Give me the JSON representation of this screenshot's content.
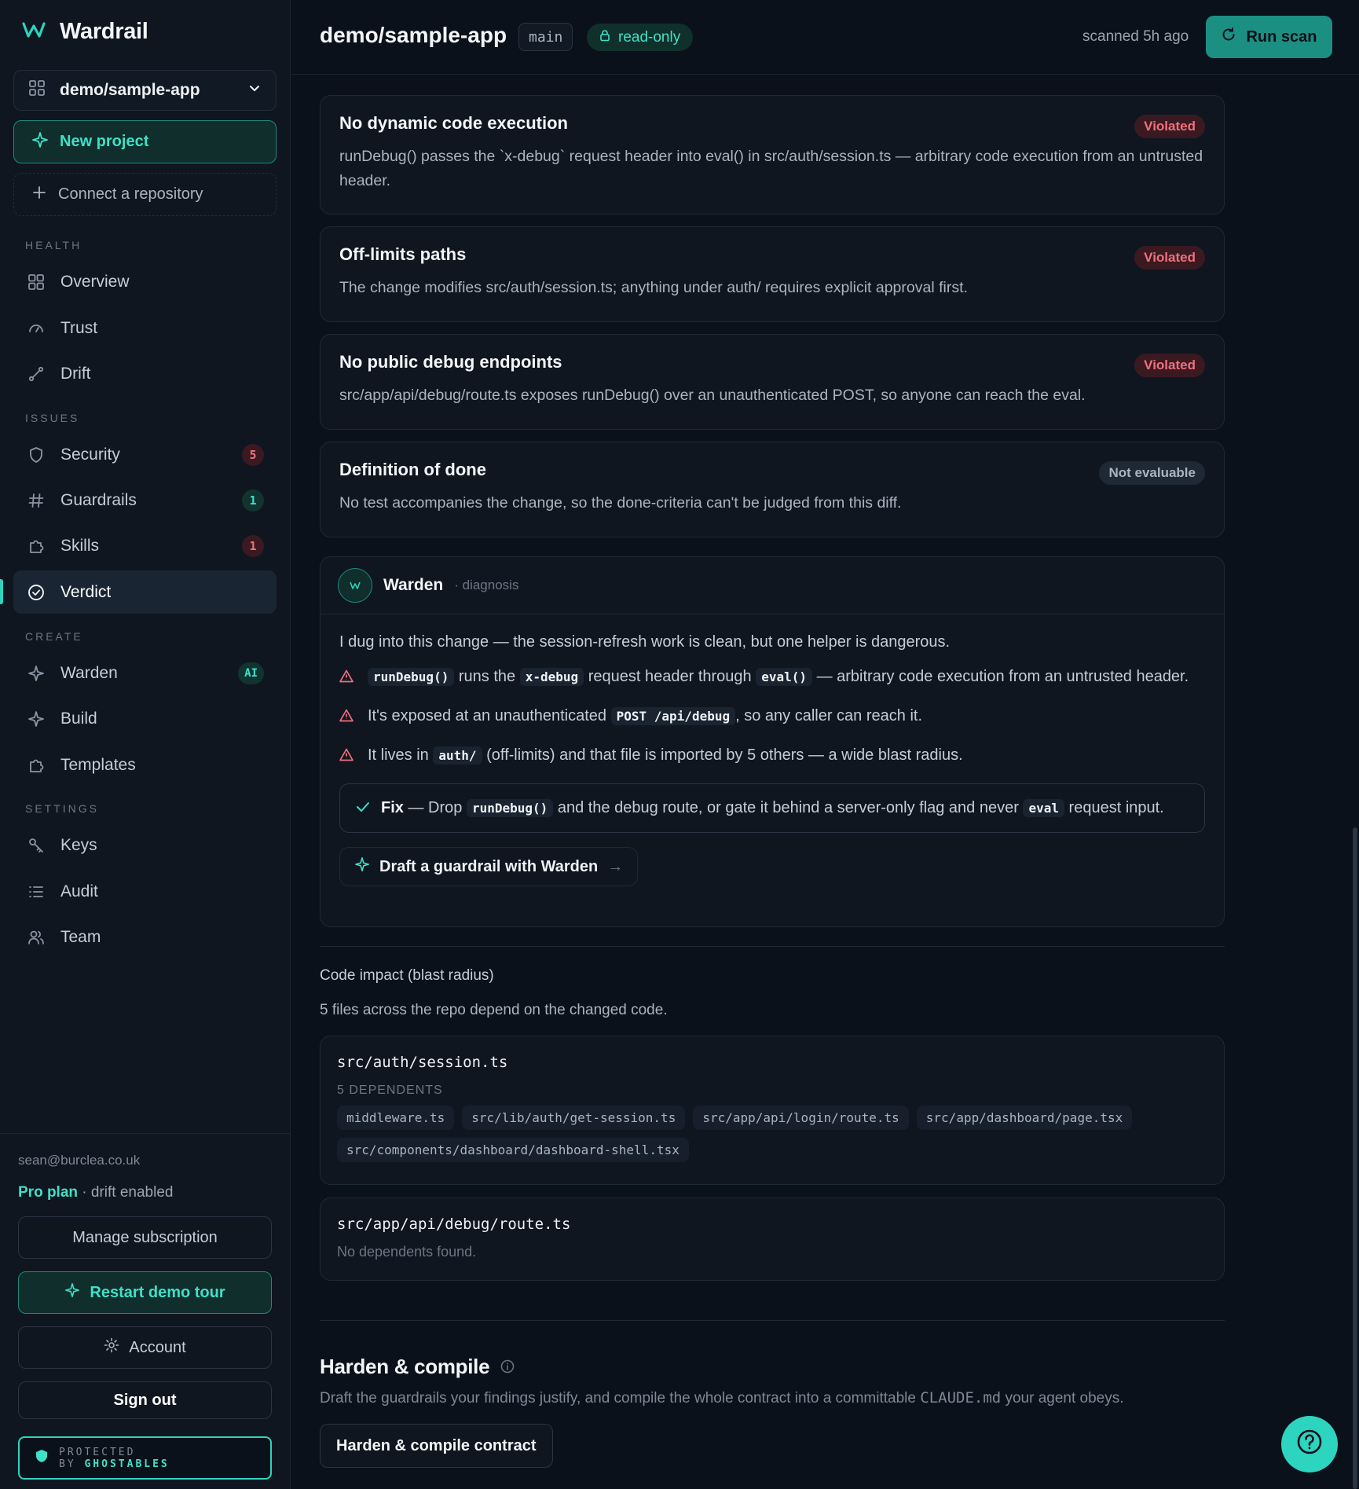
{
  "app": {
    "name": "Wardrail"
  },
  "sidebar": {
    "project_select": "demo/sample-app",
    "new_project": "New project",
    "connect_repo": "Connect a repository",
    "sections": {
      "health": "HEALTH",
      "issues": "ISSUES",
      "create": "CREATE",
      "settings": "SETTINGS"
    },
    "items": {
      "overview": "Overview",
      "trust": "Trust",
      "drift": "Drift",
      "security": "Security",
      "security_count": "5",
      "guardrails": "Guardrails",
      "guardrails_count": "1",
      "skills": "Skills",
      "skills_count": "1",
      "verdict": "Verdict",
      "warden": "Warden",
      "warden_badge": "AI",
      "build": "Build",
      "templates": "Templates",
      "keys": "Keys",
      "audit": "Audit",
      "team": "Team"
    },
    "footer": {
      "email": "sean@burclea.co.uk",
      "plan": "Pro plan",
      "plan_suffix": "· drift enabled",
      "manage": "Manage subscription",
      "restart": "Restart demo tour",
      "account": "Account",
      "sign_out": "Sign out",
      "protected_line1": "PROTECTED",
      "protected_by": "BY",
      "protected_brand": "GHOSTABLES"
    }
  },
  "header": {
    "repo": "demo/sample-app",
    "branch": "main",
    "mode": "read-only",
    "scanned": "scanned 5h ago",
    "run_scan": "Run scan"
  },
  "rules": [
    {
      "title": "No dynamic code execution",
      "status": "Violated",
      "desc": "runDebug() passes the `x-debug` request header into eval() in src/auth/session.ts — arbitrary code execution from an untrusted header."
    },
    {
      "title": "Off-limits paths",
      "status": "Violated",
      "desc": "The change modifies src/auth/session.ts; anything under auth/ requires explicit approval first."
    },
    {
      "title": "No public debug endpoints",
      "status": "Violated",
      "desc": "src/app/api/debug/route.ts exposes runDebug() over an unauthenticated POST, so anyone can reach the eval."
    },
    {
      "title": "Definition of done",
      "status": "Not evaluable",
      "desc": "No test accompanies the change, so the done-criteria can't be judged from this diff."
    }
  ],
  "warden": {
    "name": "Warden",
    "sub": "· diagnosis",
    "intro": "I dug into this change — the session-refresh work is clean, but one helper is dangerous.",
    "b1_code1": "runDebug()",
    "b1_t1": "runs the",
    "b1_code2": "x-debug",
    "b1_t2": "request header through",
    "b1_code3": "eval()",
    "b1_t3": "— arbitrary code execution from an untrusted header.",
    "b2_t1": "It's exposed at an unauthenticated",
    "b2_code": "POST /api/debug",
    "b2_t2": ", so any caller can reach it.",
    "b3_t1": "It lives in",
    "b3_code": "auth/",
    "b3_t2": "(off-limits) and that file is imported by 5 others — a wide blast radius.",
    "fix_label": "Fix",
    "fix_t1": "— Drop",
    "fix_code1": "runDebug()",
    "fix_t2": "and the debug route, or gate it behind a server-only flag and never",
    "fix_code2": "eval",
    "fix_t3": "request input.",
    "draft": "Draft a guardrail with Warden",
    "draft_arrow": "→"
  },
  "impact": {
    "heading": "Code impact (blast radius)",
    "summary": "5 files across the repo depend on the changed code.",
    "files": [
      {
        "name": "src/auth/session.ts",
        "deps_label": "5 DEPENDENTS",
        "deps": [
          "middleware.ts",
          "src/lib/auth/get-session.ts",
          "src/app/api/login/route.ts",
          "src/app/dashboard/page.tsx",
          "src/components/dashboard/dashboard-shell.tsx"
        ]
      },
      {
        "name": "src/app/api/debug/route.ts",
        "none": "No dependents found."
      }
    ]
  },
  "harden": {
    "title": "Harden & compile",
    "desc_t1": "Draft the guardrails your findings justify, and compile the whole contract into a committable",
    "desc_code": "CLAUDE.md",
    "desc_t2": "your agent obeys.",
    "button": "Harden & compile contract"
  },
  "colors": {
    "accent": "#2dd4bf",
    "danger": "#f0707e",
    "background": "#0b111a"
  },
  "icons": [
    "wardrail-logo-icon",
    "grid-icon",
    "chevron-down-icon",
    "sparkle-icon",
    "plus-icon",
    "gauge-icon",
    "drift-icon",
    "shield-icon",
    "hash-icon",
    "puzzle-icon",
    "check-circle-icon",
    "key-icon",
    "list-icon",
    "users-icon",
    "lock-icon",
    "refresh-icon",
    "warning-icon",
    "check-icon",
    "info-icon",
    "gear-icon",
    "help-icon"
  ]
}
